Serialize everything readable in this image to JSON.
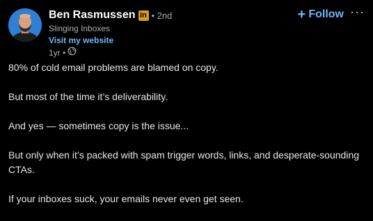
{
  "author": {
    "name": "Ben Rasmussen",
    "badge": "in",
    "degree": "• 2nd",
    "headline": "Slinging Inboxes",
    "website_link": "Visit my website",
    "time": "1yr •",
    "visibility_icon": "globe-icon"
  },
  "actions": {
    "follow_icon": "+",
    "follow_label": "Follow",
    "more_label": "···"
  },
  "post": {
    "paragraphs": [
      "80% of cold email problems are blamed on copy.",
      "But most of the time it’s deliverability.",
      "And yes — sometimes copy is the issue...",
      "But only when it’s packed with spam trigger words, links, and desperate-sounding CTAs.",
      "If your inboxes suck, your emails never even get seen."
    ]
  },
  "colors": {
    "background": "#000000",
    "link": "#71b7fb",
    "badge": "#d4a017",
    "avatar_bg": "#2f7fd4"
  }
}
